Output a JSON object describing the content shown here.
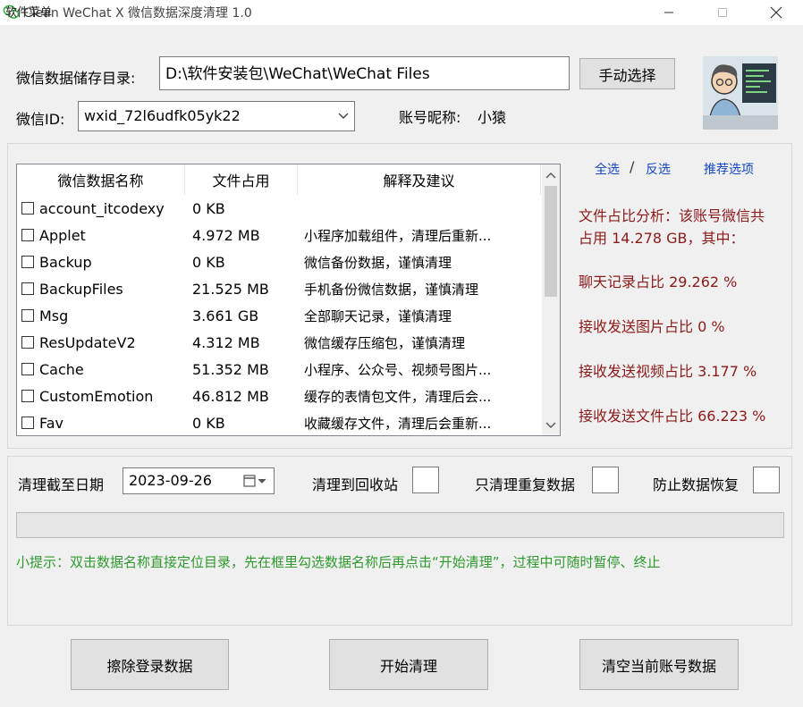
{
  "window": {
    "title": "Clean WeChat X 微信数据深度清理 1.0",
    "menu": "软件菜单"
  },
  "storage": {
    "label": "微信数据储存目录:",
    "path": "D:\\软件安装包\\WeChat\\WeChat Files",
    "choose_button": "手动选择"
  },
  "account": {
    "id_label": "微信ID:",
    "id_value": "wxid_72l6udfk05yk22",
    "nick_label": "账号昵称:",
    "nick_value": "小猿"
  },
  "table": {
    "headers": [
      "微信数据名称",
      "文件占用",
      "解释及建议"
    ],
    "rows": [
      {
        "name": "account_itcodexy",
        "size": "0 KB",
        "note": ""
      },
      {
        "name": "Applet",
        "size": "4.972 MB",
        "note": "小程序加载组件，清理后重新..."
      },
      {
        "name": "Backup",
        "size": "0 KB",
        "note": "微信备份数据，谨慎清理"
      },
      {
        "name": "BackupFiles",
        "size": "21.525 MB",
        "note": "手机备份微信数据，谨慎清理"
      },
      {
        "name": "Msg",
        "size": "3.661 GB",
        "note": "全部聊天记录，谨慎清理"
      },
      {
        "name": "ResUpdateV2",
        "size": "4.312 MB",
        "note": "微信缓存压缩包，谨慎清理"
      },
      {
        "name": "Cache",
        "size": "51.352 MB",
        "note": "小程序、公众号、视频号图片..."
      },
      {
        "name": "CustomEmotion",
        "size": "46.812 MB",
        "note": "缓存的表情包文件，清理后会..."
      },
      {
        "name": "Fav",
        "size": "0 KB",
        "note": "收藏缓存文件，清理后会重新..."
      }
    ]
  },
  "selection": {
    "select_all": "全选",
    "separator": "/",
    "invert": "反选",
    "recommend": "推荐选项"
  },
  "analysis": {
    "line1": "文件占比分析：该账号微信共",
    "line2": "占用 14.278 GB，其中：",
    "chat": "聊天记录占比 29.262 %",
    "images": "接收发送图片占比 0 %",
    "videos": "接收发送视频占比 3.177 %",
    "files": "接收发送文件占比 66.223 %"
  },
  "options": {
    "date_label": "清理截至日期",
    "date_value": "2023-09-26",
    "recycle_label": "清理到回收站",
    "dup_label": "只清理重复数据",
    "prevent_label": "防止数据恢复"
  },
  "progress": 0,
  "hint": "小提示：双击数据名称直接定位目录，先在框里勾选数据名称后再点击“开始清理”，过程中可随时暂停、终止",
  "buttons": {
    "erase_login": "擦除登录数据",
    "start": "开始清理",
    "clear_account": "清空当前账号数据"
  },
  "colors": {
    "stat_text": "#8b1a1a",
    "link": "#1447c2",
    "hint": "#2e9a2e"
  }
}
